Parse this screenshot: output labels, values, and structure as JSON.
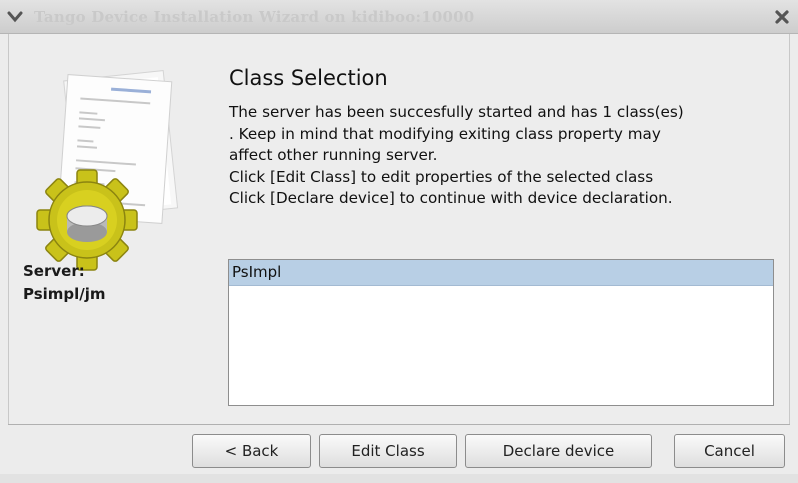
{
  "window": {
    "title": "Tango Device Installation Wizard on kidiboo:10000",
    "menu_icon": "chevron-down-icon",
    "close_icon": "close-icon"
  },
  "sidebar": {
    "illustration_icon": "gear-document-icon",
    "server_label": "Server:",
    "server_name": "Psimpl/jm"
  },
  "content": {
    "heading": "Class Selection",
    "lines": [
      "The server has been succesfully started and has 1 class(es)",
      ". Keep in mind that modifying exiting class property may",
      "affect other running server.",
      "Click [Edit Class] to edit properties of the selected class",
      "Click [Declare device] to continue with device declaration."
    ],
    "classes": [
      "PsImpl"
    ],
    "selected_class": "PsImpl"
  },
  "buttons": {
    "back": "< Back",
    "edit_class": "Edit Class",
    "declare_device": "Declare device",
    "cancel": "Cancel"
  },
  "colors": {
    "selection": "#b8cfe5",
    "gear": "#c9c21a",
    "background": "#ececec"
  }
}
